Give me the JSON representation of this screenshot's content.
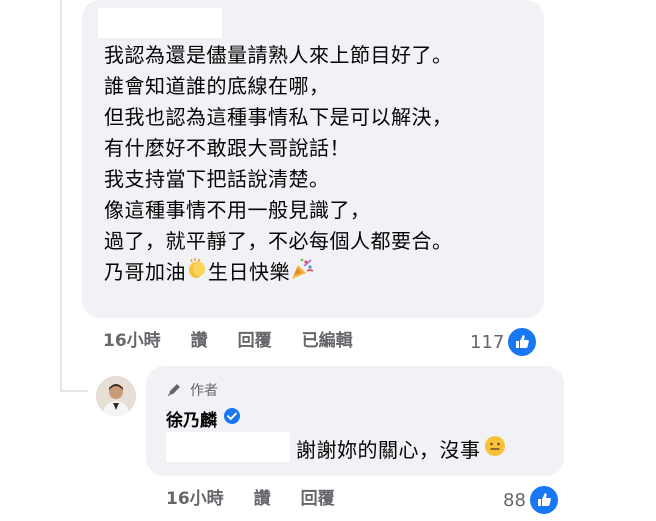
{
  "comment1": {
    "lines": [
      "我認為還是儘量請熟人來上節目好了。",
      "誰會知道誰的底線在哪，",
      "但我也認為這種事情私下是可以解決，",
      "有什麼好不敢跟大哥說話！",
      "我支持當下把話說清楚。",
      "像這種事情不用一般見識了，",
      "過了，就平靜了，不必每個人都要合。"
    ],
    "last_line_parts": [
      "乃哥加油",
      "生日快樂"
    ],
    "time": "16小時",
    "actions": [
      "讚",
      "回覆",
      "已編輯"
    ],
    "reaction_count": "117"
  },
  "reply": {
    "author_badge": "作者",
    "author_name": "徐乃麟",
    "text": "謝謝妳的關心，沒事",
    "time": "16小時",
    "actions": [
      "讚",
      "回覆"
    ],
    "reaction_count": "88"
  },
  "icons": {
    "pen": "pen-icon",
    "verified": "verified-badge-icon",
    "like": "thumbs-up-icon",
    "clap": "clapping-hands-emoji",
    "party": "party-popper-emoji",
    "smile": "slightly-smiling-face-emoji"
  },
  "colors": {
    "accent": "#1877f2",
    "bubble": "#f0f2f5",
    "meta": "#65676b"
  }
}
